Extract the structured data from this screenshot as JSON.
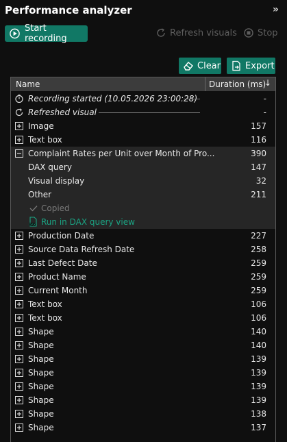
{
  "panel": {
    "title": "Performance analyzer",
    "collapse_glyph": "»"
  },
  "toolbar": {
    "start_label": "Start recording",
    "refresh_label": "Refresh visuals",
    "stop_label": "Stop"
  },
  "actions": {
    "clear_label": "Clear",
    "export_label": "Export"
  },
  "table": {
    "col_name": "Name",
    "col_duration": "Duration (ms)",
    "sort_glyph": "↓"
  },
  "rows": [
    {
      "label": "Recording started (10.05.2026 23:00:28)",
      "value": "-"
    },
    {
      "label": "Refreshed visual",
      "value": "-"
    },
    {
      "label": "Image",
      "value": "157"
    },
    {
      "label": "Text box",
      "value": "116"
    },
    {
      "label": "Complaint Rates per Unit over Month of Pro...",
      "value": "390"
    },
    {
      "label": "DAX query",
      "value": "147"
    },
    {
      "label": "Visual display",
      "value": "32"
    },
    {
      "label": "Other",
      "value": "211"
    },
    {
      "label": "Copied",
      "value": ""
    },
    {
      "label": "Run in DAX query view",
      "value": ""
    },
    {
      "label": "Production Date",
      "value": "227"
    },
    {
      "label": "Source Data Refresh Date",
      "value": "258"
    },
    {
      "label": "Last Defect Date",
      "value": "259"
    },
    {
      "label": "Product Name",
      "value": "259"
    },
    {
      "label": "Current Month",
      "value": "259"
    },
    {
      "label": "Text box",
      "value": "106"
    },
    {
      "label": "Text box",
      "value": "106"
    },
    {
      "label": "Shape",
      "value": "140"
    },
    {
      "label": "Shape",
      "value": "140"
    },
    {
      "label": "Shape",
      "value": "139"
    },
    {
      "label": "Shape",
      "value": "139"
    },
    {
      "label": "Shape",
      "value": "139"
    },
    {
      "label": "Shape",
      "value": "139"
    },
    {
      "label": "Shape",
      "value": "138"
    },
    {
      "label": "Shape",
      "value": "137"
    }
  ],
  "icons": {
    "start": "record-icon",
    "refresh": "refresh-icon",
    "stop": "stop-icon",
    "clear": "eraser-icon",
    "export": "export-icon",
    "expand": "expand-box-icon",
    "collapse": "collapse-box-icon",
    "timer": "stopwatch-icon",
    "refresh_row": "refresh-row-icon",
    "check": "checkmark-icon",
    "dax": "dax-file-icon"
  },
  "colors": {
    "accent": "#117865",
    "link": "#1ba584",
    "bg": "#0f0f0f",
    "header": "#3c3c3c"
  }
}
